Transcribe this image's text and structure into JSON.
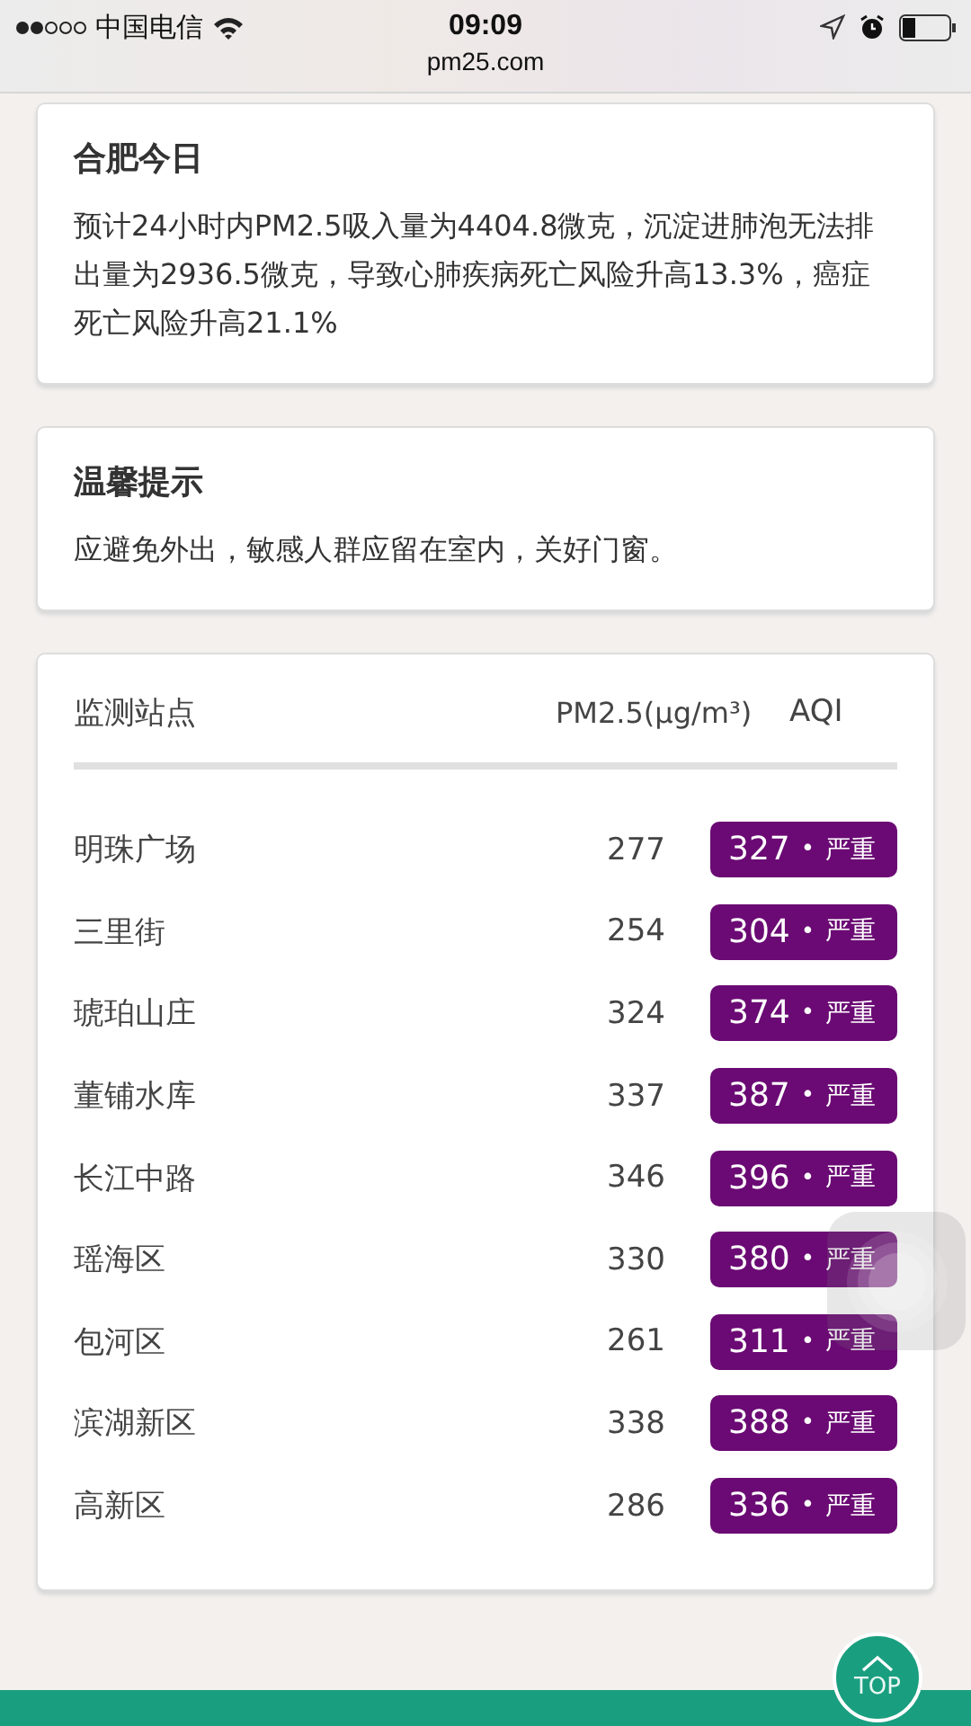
{
  "status_bar": {
    "carrier": "中国电信",
    "time": "09:09",
    "url": "pm25.com"
  },
  "today": {
    "title": "合肥今日",
    "text": "预计24小时内PM2.5吸入量为4404.8微克，沉淀进肺泡无法排出量为2936.5微克，导致心肺疾病死亡风险升高13.3%，癌症死亡风险升高21.1%"
  },
  "tips": {
    "title": "温馨提示",
    "text": "应避免外出，敏感人群应留在室内，关好门窗。"
  },
  "stations": {
    "columns": [
      "监测站点",
      "PM2.5(μg/m³)",
      "AQI"
    ],
    "rows": [
      {
        "name": "明珠广场",
        "pm25": "277",
        "aqi": "327",
        "dot": "•",
        "level": "严重",
        "color": "#6b0a74"
      },
      {
        "name": "三里街",
        "pm25": "254",
        "aqi": "304",
        "dot": "•",
        "level": "严重",
        "color": "#6b0a74"
      },
      {
        "name": "琥珀山庄",
        "pm25": "324",
        "aqi": "374",
        "dot": "•",
        "level": "严重",
        "color": "#6b0a74"
      },
      {
        "name": "董铺水库",
        "pm25": "337",
        "aqi": "387",
        "dot": "•",
        "level": "严重",
        "color": "#6b0a74"
      },
      {
        "name": "长江中路",
        "pm25": "346",
        "aqi": "396",
        "dot": "•",
        "level": "严重",
        "color": "#6b0a74"
      },
      {
        "name": "瑶海区",
        "pm25": "330",
        "aqi": "380",
        "dot": "•",
        "level": "严重",
        "color": "#6b0a74"
      },
      {
        "name": "包河区",
        "pm25": "261",
        "aqi": "311",
        "dot": "•",
        "level": "严重",
        "color": "#6b0a74"
      },
      {
        "name": "滨湖新区",
        "pm25": "338",
        "aqi": "388",
        "dot": "•",
        "level": "严重",
        "color": "#6b0a74"
      },
      {
        "name": "高新区",
        "pm25": "286",
        "aqi": "336",
        "dot": "•",
        "level": "严重",
        "color": "#6b0a74"
      }
    ]
  },
  "top_button": {
    "label": "TOP"
  }
}
